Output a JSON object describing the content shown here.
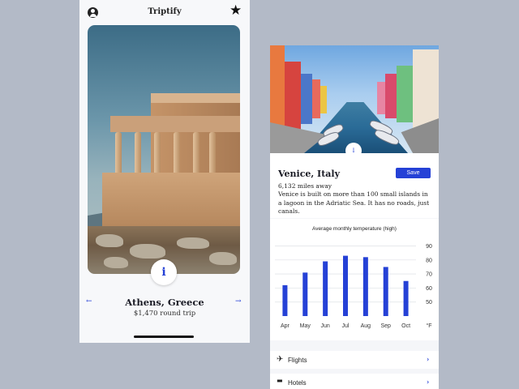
{
  "left_screen": {
    "app_title": "Triptify",
    "profile_icon": "user-circle-icon",
    "favorite_icon": "star-icon",
    "info_label": "i",
    "destination": "Athens, Greece",
    "price": "$1,470 round trip",
    "prev_arrow": "←",
    "next_arrow": "→"
  },
  "right_screen": {
    "scroll_down_arrow": "↓",
    "destination": "Venice, Italy",
    "save_label": "Save",
    "distance": "6,132 miles away",
    "description": "Venice is built on more than 100 small islands in a lagoon in the Adriatic Sea. It has no roads, just canals.",
    "list": [
      {
        "icon": "airplane-icon",
        "glyph": "✈",
        "label": "Flights",
        "chevron": "›"
      },
      {
        "icon": "bed-icon",
        "glyph": "🛏",
        "label": "Hotels",
        "chevron": "›"
      }
    ]
  },
  "colors": {
    "accent": "#2541d6",
    "background": "#b3bac7"
  },
  "chart_data": {
    "type": "bar",
    "title": "Average monthly temperature (high)",
    "categories": [
      "Apr",
      "May",
      "Jun",
      "Jul",
      "Aug",
      "Sep",
      "Oct"
    ],
    "values": [
      62,
      71,
      79,
      83,
      82,
      75,
      65
    ],
    "yticks": [
      50,
      60,
      70,
      80,
      90
    ],
    "ylim": [
      40,
      92
    ],
    "unit": "°F",
    "grid": true,
    "color": "#2541d6"
  }
}
